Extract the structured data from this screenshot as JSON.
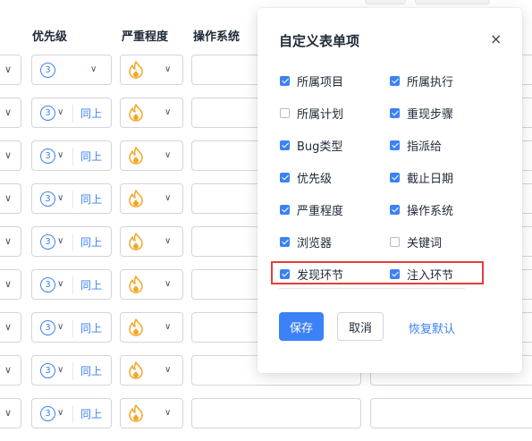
{
  "table": {
    "columns": {
      "priority": "优先级",
      "severity": "严重程度",
      "os": "操作系统"
    },
    "rows": [
      {
        "priority": "3",
        "same_label": ""
      },
      {
        "priority": "3",
        "same_label": "同上"
      },
      {
        "priority": "3",
        "same_label": "同上"
      },
      {
        "priority": "3",
        "same_label": "同上"
      },
      {
        "priority": "3",
        "same_label": "同上"
      },
      {
        "priority": "3",
        "same_label": "同上"
      },
      {
        "priority": "3",
        "same_label": "同上"
      },
      {
        "priority": "3",
        "same_label": "同上"
      },
      {
        "priority": "3",
        "same_label": "同上"
      }
    ]
  },
  "popup": {
    "title": "自定义表单项",
    "close_symbol": "×",
    "options": [
      {
        "label": "所属项目",
        "checked": true
      },
      {
        "label": "所属执行",
        "checked": true
      },
      {
        "label": "所属计划",
        "checked": false
      },
      {
        "label": "重现步骤",
        "checked": true
      },
      {
        "label": "Bug类型",
        "checked": true
      },
      {
        "label": "指派给",
        "checked": true
      },
      {
        "label": "优先级",
        "checked": true
      },
      {
        "label": "截止日期",
        "checked": true
      },
      {
        "label": "严重程度",
        "checked": true
      },
      {
        "label": "操作系统",
        "checked": true
      },
      {
        "label": "浏览器",
        "checked": true
      },
      {
        "label": "关键词",
        "checked": false
      },
      {
        "label": "发现环节",
        "checked": true
      },
      {
        "label": "注入环节",
        "checked": true
      }
    ],
    "save_label": "保存",
    "cancel_label": "取消",
    "reset_label": "恢复默认"
  },
  "colors": {
    "accent": "#3b82f6",
    "highlight": "#e53e3e",
    "severity": "#f5a623"
  },
  "icons": {
    "severity": "flame-icon",
    "priority": "circle-number-icon",
    "dropdown": "chevron-down-icon",
    "close": "close-icon",
    "checkbox": "check-icon"
  }
}
